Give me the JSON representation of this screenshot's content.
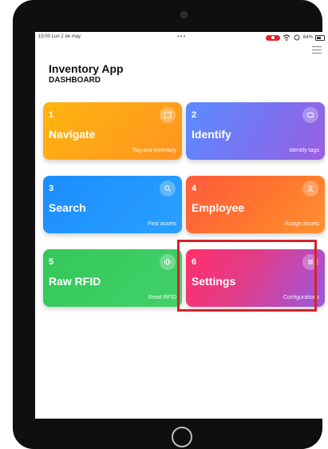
{
  "status_bar": {
    "time": "15:00",
    "date": "Lun 2 de may",
    "dots": "•••",
    "battery_percent": "64%"
  },
  "header": {
    "title": "Inventory App",
    "subtitle": "DASHBOARD"
  },
  "cards": [
    {
      "number": "1",
      "title": "Navigate",
      "subtitle": "Tag and inventory",
      "icon": "map-icon"
    },
    {
      "number": "2",
      "title": "Identify",
      "subtitle": "Identify tags",
      "icon": "tag-icon"
    },
    {
      "number": "3",
      "title": "Search",
      "subtitle": "Find assets",
      "icon": "search-icon"
    },
    {
      "number": "4",
      "title": "Employee",
      "subtitle": "Assign assets",
      "icon": "person-icon"
    },
    {
      "number": "5",
      "title": "Raw RFID",
      "subtitle": "Read RFID",
      "icon": "rfid-icon"
    },
    {
      "number": "6",
      "title": "Settings",
      "subtitle": "Configurations",
      "icon": "list-icon"
    }
  ],
  "colors": {
    "navigate": "#ffa31a",
    "identify": "#7a72f0",
    "search": "#1b8dff",
    "employee": "#ff6a34",
    "raw_rfid": "#34c759",
    "settings": "#e03d8a",
    "highlight": "#d6222b"
  }
}
